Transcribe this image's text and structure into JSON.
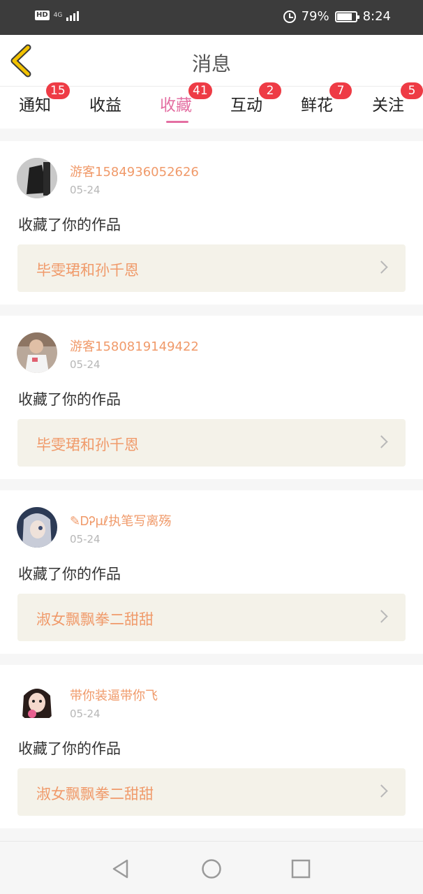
{
  "status_bar": {
    "hd": "HD",
    "network": "4G",
    "battery_percent": "79%",
    "battery_level": 0.79,
    "time": "8:24"
  },
  "header": {
    "title": "消息"
  },
  "tabs": [
    {
      "label": "通知",
      "badge": "15",
      "active": false
    },
    {
      "label": "收益",
      "badge": "",
      "active": false
    },
    {
      "label": "收藏",
      "badge": "41",
      "active": true
    },
    {
      "label": "互动",
      "badge": "2",
      "active": false
    },
    {
      "label": "鲜花",
      "badge": "7",
      "active": false
    },
    {
      "label": "关注",
      "badge": "5",
      "active": false
    }
  ],
  "messages": [
    {
      "username": "游客1584936052626",
      "date": "05-24",
      "action": "收藏了你的作品",
      "work_title": "毕雯珺和孙千恩"
    },
    {
      "username": "游客1580819149422",
      "date": "05-24",
      "action": "收藏了你的作品",
      "work_title": "毕雯珺和孙千恩"
    },
    {
      "username": "✎ᎠᎮμℓ执笔写离殇",
      "date": "05-24",
      "action": "收藏了你的作品",
      "work_title": "淑女飘飘拳二甜甜"
    },
    {
      "username": "带你装逼带你飞",
      "date": "05-24",
      "action": "收藏了你的作品",
      "work_title": "淑女飘飘拳二甜甜"
    }
  ],
  "colors": {
    "accent": "#e46fa2",
    "badge": "#ee3b45",
    "username": "#f09a6a",
    "back_icon": "#f2c200"
  }
}
